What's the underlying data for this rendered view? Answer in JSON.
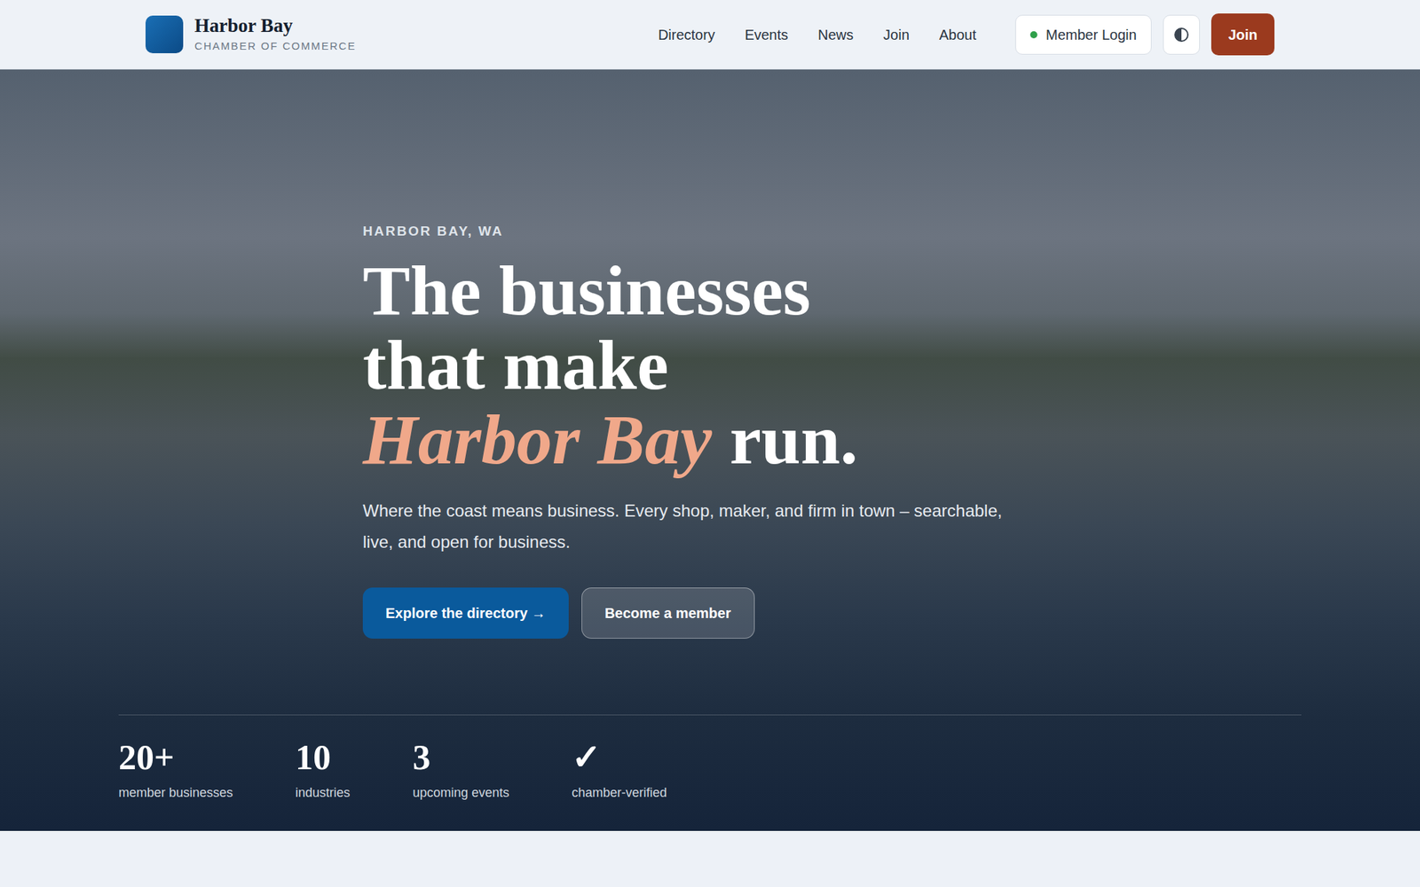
{
  "brand": {
    "name": "Harbor Bay",
    "tagline": "CHAMBER OF COMMERCE"
  },
  "nav": [
    {
      "label": "Directory",
      "selected": false
    },
    {
      "label": "Events",
      "selected": false
    },
    {
      "label": "News",
      "selected": false
    },
    {
      "label": "Join",
      "selected": false
    },
    {
      "label": "About",
      "selected": false
    }
  ],
  "header_actions": {
    "member_login": {
      "label": "Member Login",
      "online": true
    },
    "join": "Join"
  },
  "hero": {
    "eyebrow": "HARBOR BAY, WA",
    "title": {
      "line1": "The businesses",
      "line2": "that make",
      "highlight": "Harbor Bay",
      "line3_end": "run."
    },
    "subtitle": "Where the coast means business. Every shop, maker, and firm in town – searchable, live, and open for business.",
    "buttons": [
      "Explore the directory →",
      "Become a member"
    ]
  },
  "stats": [
    {
      "value": "20+",
      "label": "member businesses"
    },
    {
      "value": "10",
      "label": "industries"
    },
    {
      "value": "3",
      "label": "upcoming events"
    },
    {
      "value": "✓",
      "label": "chamber-verified"
    }
  ]
}
